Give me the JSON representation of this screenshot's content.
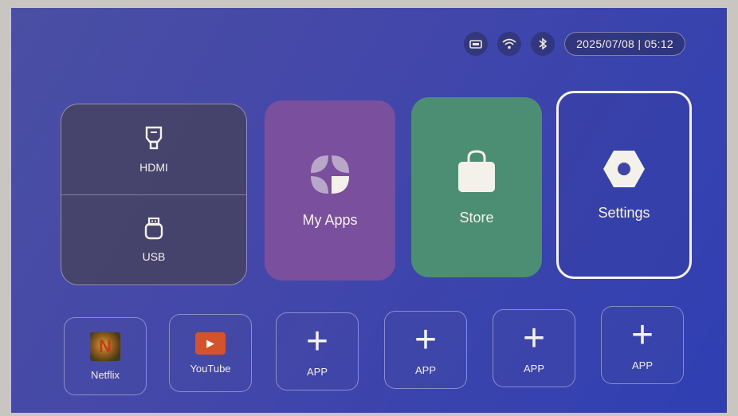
{
  "status": {
    "datetime": "2025/07/08 | 05:12",
    "icons": [
      "network-icon",
      "wifi-icon",
      "bluetooth-icon"
    ]
  },
  "sources": {
    "hdmi_label": "HDMI",
    "usb_label": "USB"
  },
  "tiles": {
    "my_apps": "My Apps",
    "store": "Store",
    "settings": "Settings"
  },
  "shortcuts": [
    {
      "label": "Netflix",
      "icon": "netflix-icon"
    },
    {
      "label": "YouTube",
      "icon": "youtube-icon"
    },
    {
      "label": "APP",
      "icon": "plus-icon"
    },
    {
      "label": "APP",
      "icon": "plus-icon"
    },
    {
      "label": "APP",
      "icon": "plus-icon"
    },
    {
      "label": "APP",
      "icon": "plus-icon"
    }
  ],
  "colors": {
    "background": "#3f47aa",
    "my_apps": "#7a4f9e",
    "store": "#4c8e74",
    "focus_border": "#f5f3ee"
  }
}
